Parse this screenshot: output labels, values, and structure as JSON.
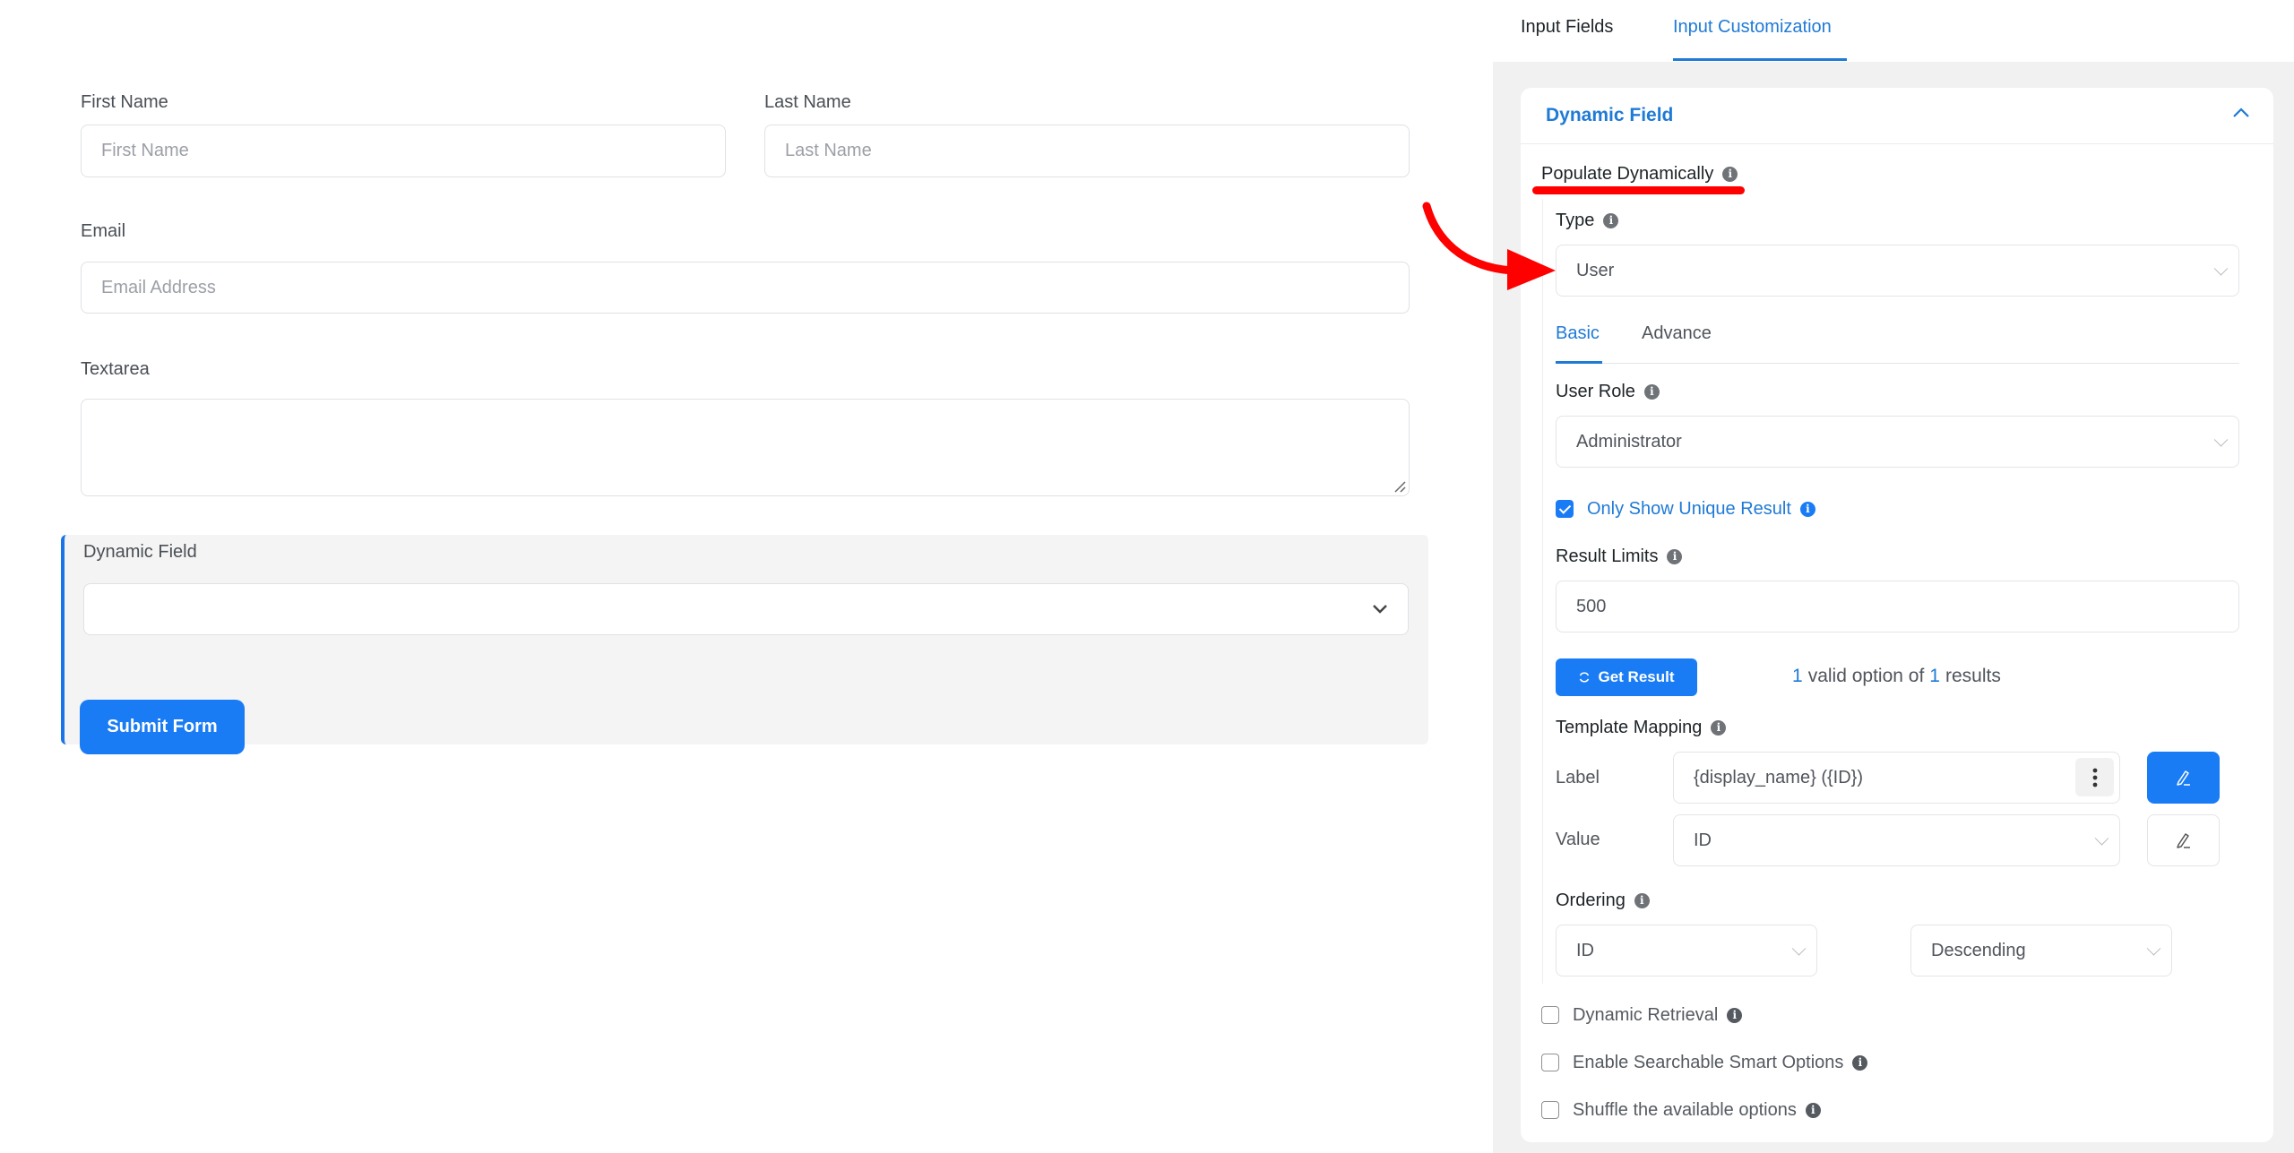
{
  "form": {
    "first_name": {
      "label": "First Name",
      "placeholder": "First Name"
    },
    "last_name": {
      "label": "Last Name",
      "placeholder": "Last Name"
    },
    "email": {
      "label": "Email",
      "placeholder": "Email Address"
    },
    "textarea": {
      "label": "Textarea",
      "value": ""
    },
    "dynamic_field": {
      "label": "Dynamic Field",
      "value": ""
    },
    "submit_label": "Submit Form"
  },
  "panel": {
    "tabs": [
      {
        "label": "Input Fields",
        "active": false
      },
      {
        "label": "Input Customization",
        "active": true
      }
    ],
    "section_title": "Dynamic Field",
    "populate_label": "Populate Dynamically",
    "type": {
      "label": "Type",
      "value": "User"
    },
    "subtabs": [
      {
        "label": "Basic",
        "active": true
      },
      {
        "label": "Advance",
        "active": false
      }
    ],
    "user_role": {
      "label": "User Role",
      "value": "Administrator"
    },
    "unique_result": {
      "label": "Only Show Unique Result",
      "checked": true
    },
    "result_limits": {
      "label": "Result Limits",
      "value": "500"
    },
    "get_result_label": "Get Result",
    "results_summary": {
      "valid": "1",
      "middle": "valid option of",
      "total": "1",
      "suffix": "results"
    },
    "template_mapping": {
      "label": "Template Mapping",
      "label_row": {
        "name": "Label",
        "value": "{display_name} ({ID})"
      },
      "value_row": {
        "name": "Value",
        "value": "ID"
      }
    },
    "ordering": {
      "label": "Ordering",
      "field": "ID",
      "direction": "Descending"
    },
    "options": [
      {
        "label": "Dynamic Retrieval",
        "checked": false
      },
      {
        "label": "Enable Searchable Smart Options",
        "checked": false
      },
      {
        "label": "Shuffle the available options",
        "checked": false
      }
    ]
  },
  "colors": {
    "accent": "#1a7cf5",
    "annotation": "#ff0000"
  }
}
